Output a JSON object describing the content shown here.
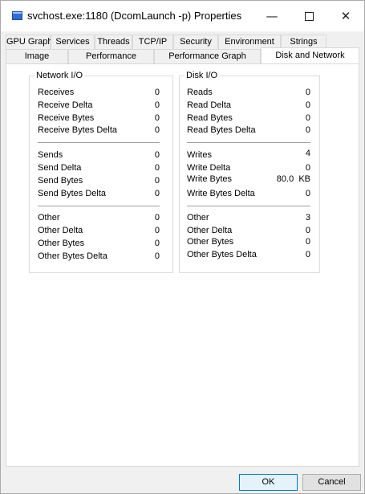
{
  "window": {
    "title": "svchost.exe:1180 (DcomLaunch -p) Properties",
    "controls": {
      "minimize": "—",
      "close": "✕"
    }
  },
  "tabs": {
    "top_row": [
      "GPU Graph",
      "Services",
      "Threads",
      "TCP/IP",
      "Security",
      "Environment",
      "Strings"
    ],
    "bottom_row": [
      "Image",
      "Performance",
      "Performance Graph",
      "Disk and Network"
    ],
    "selected": "Disk and Network"
  },
  "network_io": {
    "title": "Network I/O",
    "groups": [
      [
        {
          "label": "Receives",
          "value": "0"
        },
        {
          "label": "Receive Delta",
          "value": "0"
        },
        {
          "label": "Receive Bytes",
          "value": "0"
        },
        {
          "label": "Receive Bytes Delta",
          "value": "0"
        }
      ],
      [
        {
          "label": "Sends",
          "value": "0"
        },
        {
          "label": "Send Delta",
          "value": "0"
        },
        {
          "label": "Send Bytes",
          "value": "0"
        },
        {
          "label": "Send Bytes Delta",
          "value": "0"
        }
      ],
      [
        {
          "label": "Other",
          "value": "0"
        },
        {
          "label": "Other Delta",
          "value": "0"
        },
        {
          "label": "Other Bytes",
          "value": "0"
        },
        {
          "label": "Other Bytes Delta",
          "value": "0"
        }
      ]
    ]
  },
  "disk_io": {
    "title": "Disk I/O",
    "groups": [
      [
        {
          "label": "Reads",
          "value": "0"
        },
        {
          "label": "Read Delta",
          "value": "0"
        },
        {
          "label": "Read Bytes",
          "value": "0"
        },
        {
          "label": "Read Bytes Delta",
          "value": "0"
        }
      ],
      [
        {
          "label": "Writes",
          "value": "4"
        },
        {
          "label": "Write Delta",
          "value": "0"
        },
        {
          "label": "Write Bytes",
          "value": "80.0  KB"
        },
        {
          "label": "Write Bytes Delta",
          "value": "0"
        }
      ],
      [
        {
          "label": "Other",
          "value": "3"
        },
        {
          "label": "Other Delta",
          "value": "0"
        },
        {
          "label": "Other Bytes",
          "value": "0"
        },
        {
          "label": "Other Bytes Delta",
          "value": "0"
        }
      ]
    ]
  },
  "buttons": {
    "ok": "OK",
    "cancel": "Cancel"
  }
}
